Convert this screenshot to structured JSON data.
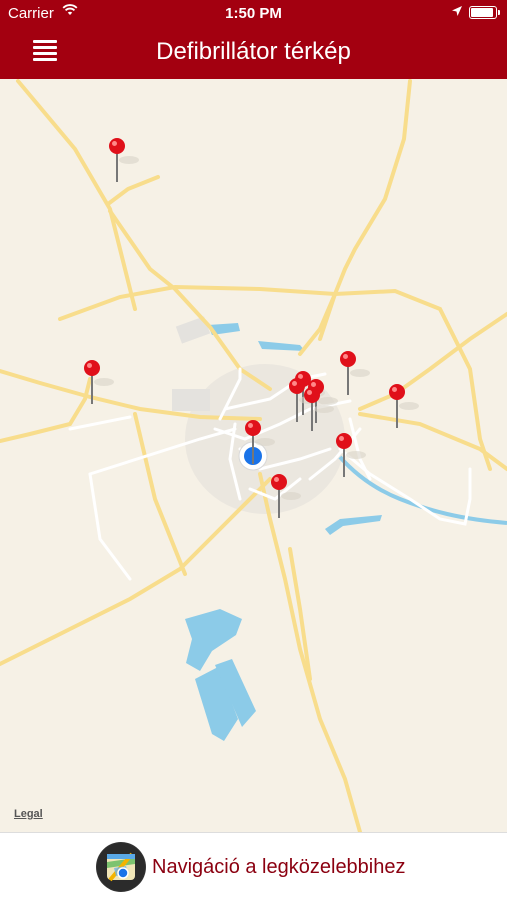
{
  "status_bar": {
    "carrier": "Carrier",
    "time": "1:50 PM"
  },
  "header": {
    "title": "Defibrillátor térkép",
    "menu_icon": "hamburger-menu-icon"
  },
  "map": {
    "legal_label": "Legal",
    "marker_icon": "red-pin-icon",
    "location_icon": "user-location-icon"
  },
  "bottom_bar": {
    "nav_button_label": "Navigáció a legközelebbihez",
    "nav_icon": "maps-navigation-icon"
  },
  "colors": {
    "header_bg": "#a30010",
    "nav_text": "#8b0010",
    "map_bg": "#f6f1e6",
    "road": "#f8dd8c",
    "water": "#8ccbe8",
    "pin": "#e0101a"
  }
}
